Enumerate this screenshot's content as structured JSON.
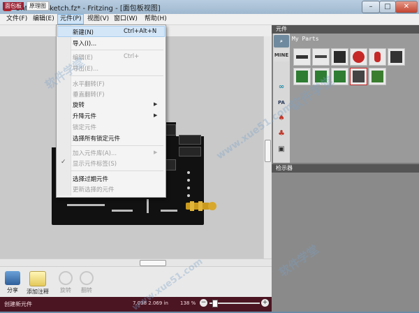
{
  "window": {
    "title": "Untitled Sketch.fz* - Fritzing - [面包板视图]",
    "app_icon_letter": "f",
    "minimize": "–",
    "maximize": "□",
    "close": "✕"
  },
  "menubar": [
    "文件(F)",
    "编辑(E)",
    "元件(P)",
    "视图(V)",
    "窗口(W)",
    "帮助(H)"
  ],
  "view_tabs": [
    "面包板",
    "原理图"
  ],
  "part_menu": {
    "items": [
      {
        "label": "新建(N)",
        "shortcut": "Ctrl+Alt+N",
        "enabled": true
      },
      {
        "label": "导入(I)...",
        "shortcut": "",
        "enabled": true
      },
      {
        "label": "编辑(E)",
        "shortcut": "Ctrl+",
        "enabled": false
      },
      {
        "label": "导出(E)...",
        "shortcut": "",
        "enabled": false
      },
      {
        "label": "水平翻转(F)",
        "shortcut": "",
        "enabled": false
      },
      {
        "label": "垂直翻转(F)",
        "shortcut": "",
        "enabled": false
      },
      {
        "label": "旋转",
        "shortcut": "",
        "enabled": true,
        "submenu": true
      },
      {
        "label": "升降元件",
        "shortcut": "",
        "enabled": true,
        "submenu": true
      },
      {
        "label": "锁定元件",
        "shortcut": "",
        "enabled": false
      },
      {
        "label": "选择所有锁定元件",
        "shortcut": "",
        "enabled": true
      },
      {
        "label": "加入元件库(A)...",
        "shortcut": "",
        "enabled": false,
        "submenu": true
      },
      {
        "label": "显示元件标签(S)",
        "shortcut": "",
        "enabled": false,
        "checked": true
      },
      {
        "label": "选择过期元件",
        "shortcut": "",
        "enabled": true
      },
      {
        "label": "更新选择的元件",
        "shortcut": "",
        "enabled": false
      }
    ]
  },
  "dock": {
    "parts_title": "元件",
    "bin_name": "My Parts",
    "bin_tabs": [
      "search-icon",
      "MINE",
      "arduino-icon",
      "PA",
      "sparkfun-icon",
      "seeed-icon"
    ],
    "inspector_title": "检示器"
  },
  "toolbar": {
    "share": "分享",
    "add_note": "添加注释",
    "rotate": "旋转",
    "flip": "翻转"
  },
  "status": {
    "text": "创建新元件",
    "coords": "7.038 2.069 in",
    "zoom": "138 %",
    "zoom_minus": "−",
    "zoom_plus": "+"
  },
  "watermark": [
    "软件学堂",
    "www.xue51.com"
  ],
  "colors": {
    "brand": "#9b2335",
    "statusbar": "#4b1522",
    "menu_highlight": "#d3e6f8"
  }
}
